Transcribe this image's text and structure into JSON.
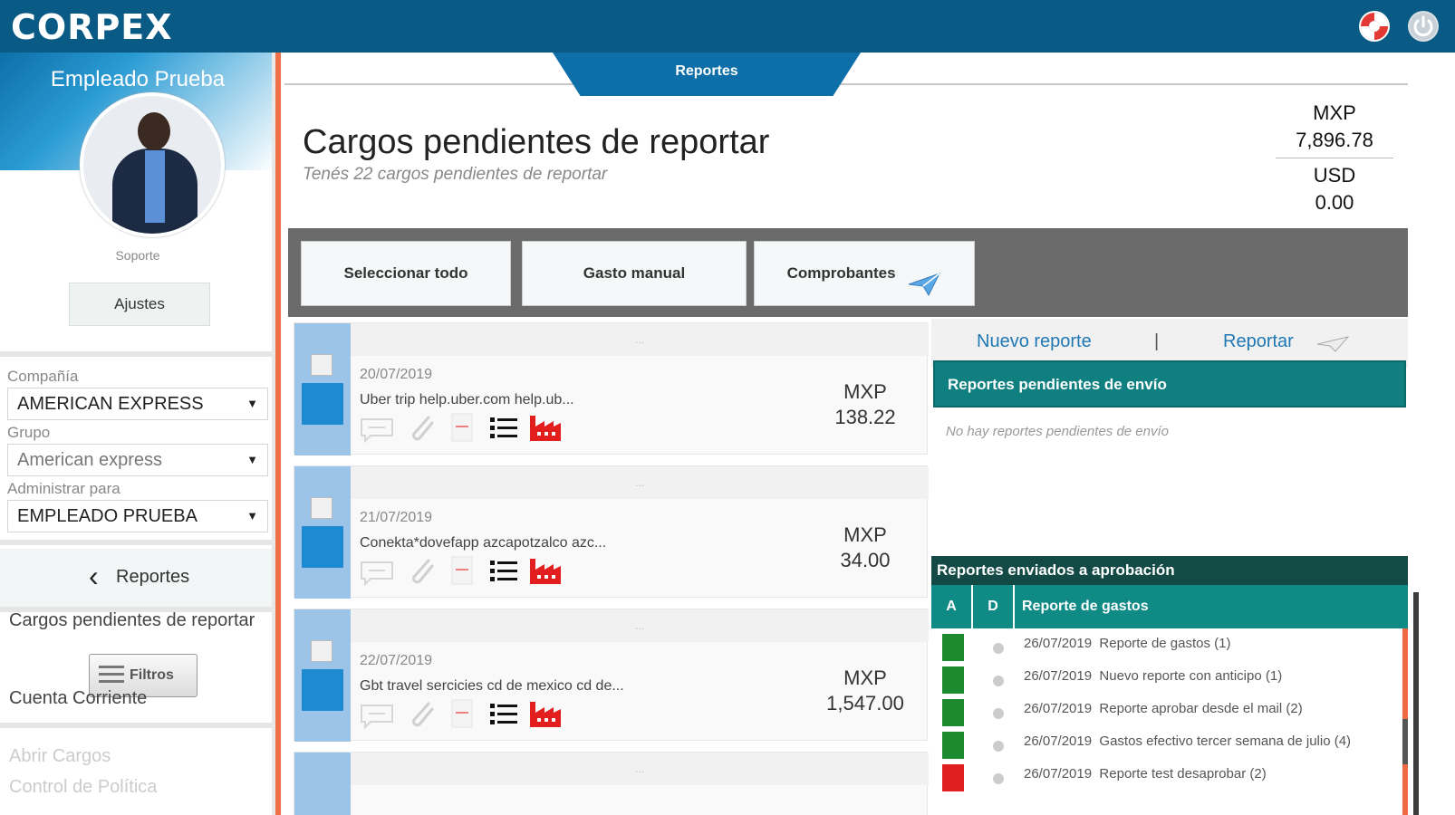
{
  "app": {
    "logo": "CORPEX",
    "colors": {
      "topbar": "#0a5a86",
      "accent_orange": "#f0704a",
      "teal": "#0f7f7f",
      "link": "#1f78b4",
      "green_status": "#1e8a2f",
      "red_status": "#e02020"
    }
  },
  "topbar": {
    "help_icon": "lifebuoy-icon",
    "power_icon": "power-icon"
  },
  "sidebar": {
    "employee_name": "Empleado Prueba",
    "role": "Soporte",
    "ajustes": "Ajustes",
    "compania_label": "Compañía",
    "compania_value": "AMERICAN EXPRESS",
    "grupo_label": "Grupo",
    "grupo_value": "American express",
    "admin_label": "Administrar para",
    "admin_value": "EMPLEADO PRUEBA",
    "reportes_nav": "Reportes",
    "item_cargos": "Cargos pendientes de reportar",
    "filtros": "Filtros",
    "item_cuenta": "Cuenta Corriente",
    "item_abrir": "Abrir Cargos",
    "item_control": "Control de Política"
  },
  "main": {
    "tab": "Reportes",
    "title": "Cargos pendientes de reportar",
    "subtitle": "Tenés 22 cargos pendientes de reportar",
    "totals": {
      "cur1": "MXP",
      "amt1": "7,896.78",
      "cur2": "USD",
      "amt2": "0.00"
    },
    "toolbar": {
      "select_all": "Seleccionar todo",
      "manual": "Gasto manual",
      "comprobantes": "Comprobantes"
    },
    "cards": [
      {
        "strip": "...",
        "date": "20/07/2019",
        "desc": "Uber trip help.uber.com help.ub...",
        "currency": "MXP",
        "amount": "138.22"
      },
      {
        "strip": "...",
        "date": "21/07/2019",
        "desc": "Conekta*dovefapp azcapotzalco azc...",
        "currency": "MXP",
        "amount": "34.00"
      },
      {
        "strip": "...",
        "date": "22/07/2019",
        "desc": "Gbt travel sercicies cd de mexico cd de...",
        "currency": "MXP",
        "amount": "1,547.00"
      },
      {
        "strip": "..."
      }
    ]
  },
  "right_panel": {
    "nuevo_reporte": "Nuevo reporte",
    "pipe": "|",
    "reportar": "Reportar",
    "pending_header": "Reportes pendientes de envío",
    "pending_empty": "No hay reportes pendientes de envío",
    "sent_header": "Reportes enviados a aprobación",
    "col_a": "A",
    "col_d": "D",
    "col_reporte": "Reporte de gastos",
    "sent_rows": [
      {
        "date": "26/07/2019",
        "name": "Reporte de gastos (1)",
        "status": "green"
      },
      {
        "date": "26/07/2019",
        "name": "Nuevo reporte con anticipo (1)",
        "status": "green"
      },
      {
        "date": "26/07/2019",
        "name": "Reporte aprobar desde el mail (2)",
        "status": "green"
      },
      {
        "date": "26/07/2019",
        "name": "Gastos efectivo tercer semana de julio (4)",
        "status": "green"
      },
      {
        "date": "26/07/2019",
        "name": "Reporte test desaprobar (2)",
        "status": "red"
      }
    ]
  }
}
